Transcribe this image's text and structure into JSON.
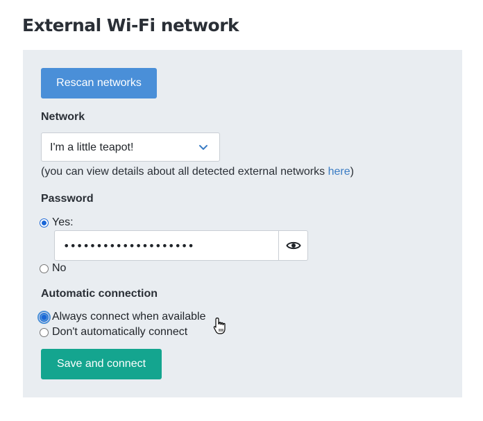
{
  "page": {
    "title": "External Wi-Fi network"
  },
  "actions": {
    "rescan_label": "Rescan networks",
    "save_label": "Save and connect"
  },
  "network": {
    "label": "Network",
    "selected": "I'm a little teapot!",
    "hint_prefix": "(you can view details about all detected external networks ",
    "hint_link": "here",
    "hint_suffix": ")"
  },
  "password": {
    "label": "Password",
    "yes_label": "Yes:",
    "no_label": "No",
    "value": "••••••••••••••••••••",
    "selected": "yes"
  },
  "auto_connect": {
    "label": "Automatic connection",
    "always_label": "Always connect when available",
    "dont_label": "Don't automatically connect",
    "selected": "always"
  },
  "colors": {
    "primary_button": "#4a8fd8",
    "success_button": "#14a58f",
    "panel_bg": "#e9edf1",
    "link": "#3a7cc4"
  }
}
